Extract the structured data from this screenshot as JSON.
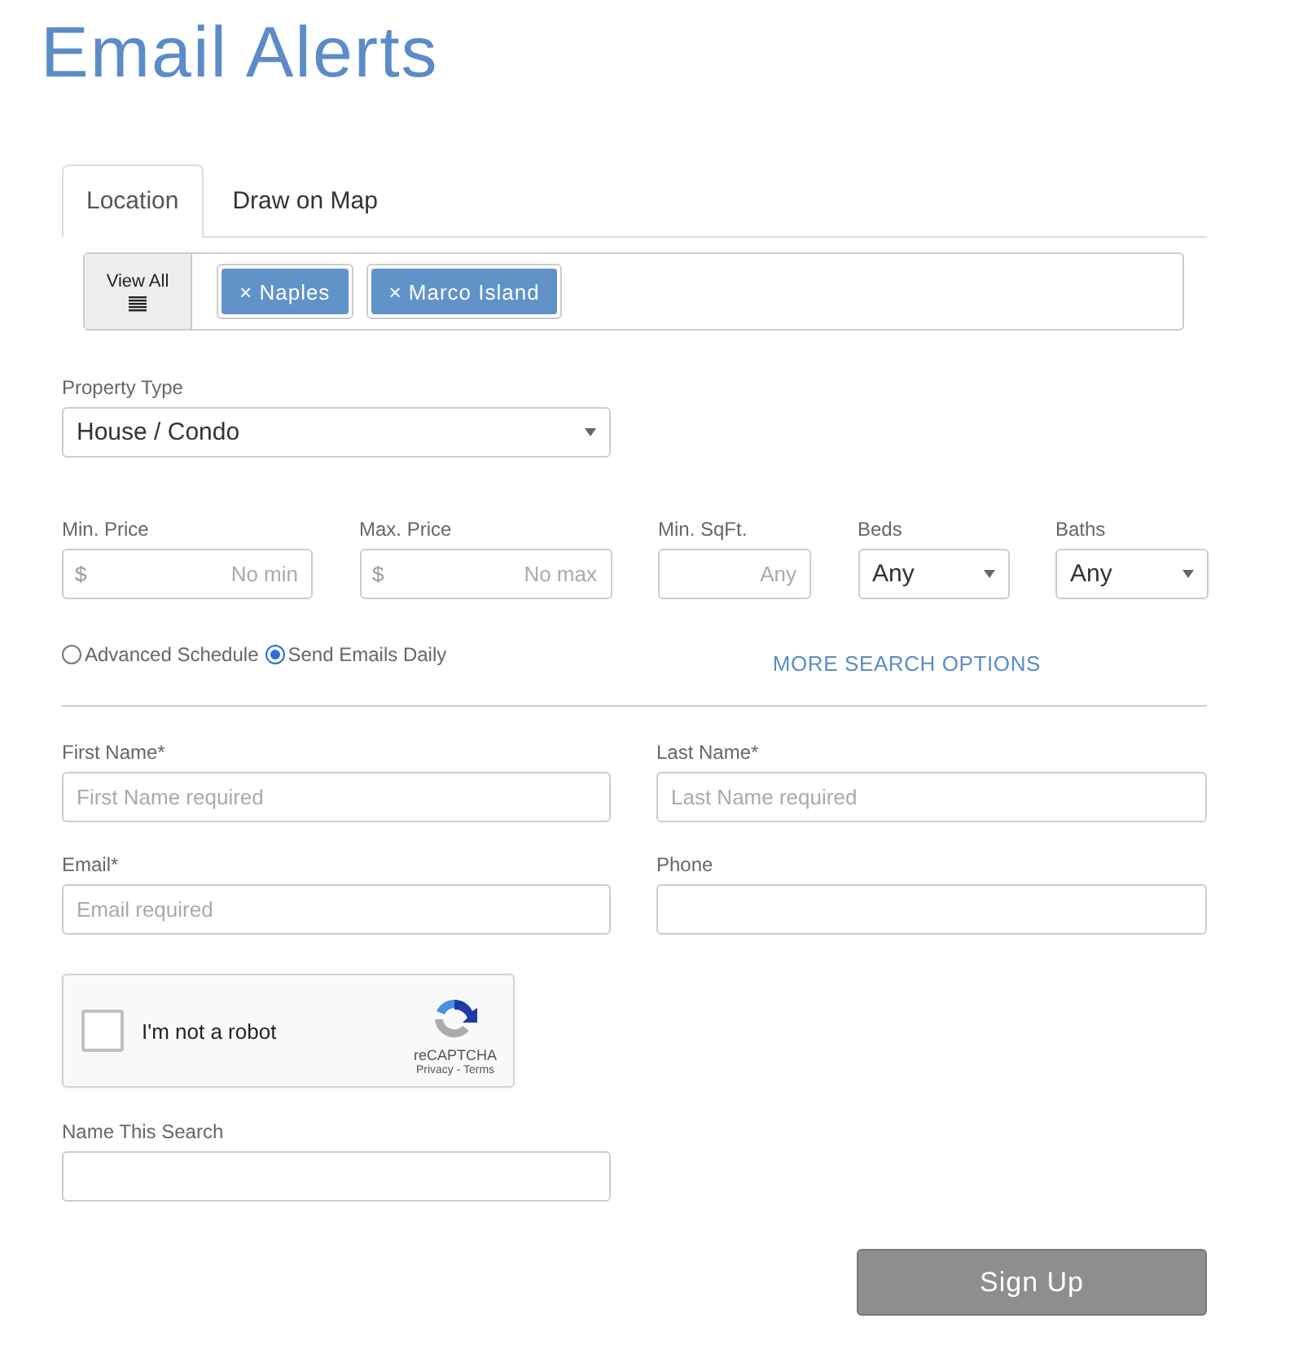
{
  "title": "Email Alerts",
  "tabs": [
    {
      "label": "Location",
      "selected": true
    },
    {
      "label": "Draw on Map",
      "selected": false
    }
  ],
  "location_bar": {
    "view_all": "View All",
    "chips": [
      {
        "remove": "×",
        "label": "Naples"
      },
      {
        "remove": "×",
        "label": "Marco Island"
      }
    ]
  },
  "property_type": {
    "label": "Property Type",
    "value": "House / Condo"
  },
  "filters": [
    {
      "kind": "price",
      "label": "Min. Price",
      "prefix": "$",
      "placeholder": "No min"
    },
    {
      "kind": "price",
      "label": "Max. Price",
      "prefix": "$",
      "placeholder": "No max"
    },
    {
      "kind": "number",
      "label": "Min. SqFt.",
      "placeholder": "Any"
    },
    {
      "kind": "select",
      "label": "Beds",
      "value": "Any"
    },
    {
      "kind": "select",
      "label": "Baths",
      "value": "Any"
    }
  ],
  "schedule": [
    {
      "label": "Advanced Schedule",
      "selected": false
    },
    {
      "label": "Send Emails Daily",
      "selected": true
    }
  ],
  "more_link": "MORE SEARCH OPTIONS",
  "contact_fields": [
    {
      "label": "First Name*",
      "placeholder": "First Name required"
    },
    {
      "label": "Last Name*",
      "placeholder": "Last Name required"
    },
    {
      "label": "Email*",
      "placeholder": "Email required"
    },
    {
      "label": "Phone"
    }
  ],
  "captcha": {
    "checked": false,
    "label": "I'm not a robot",
    "brand": "reCAPTCHA",
    "links": "Privacy - Terms"
  },
  "name_search": {
    "label": "Name This Search"
  },
  "submit": "Sign Up"
}
